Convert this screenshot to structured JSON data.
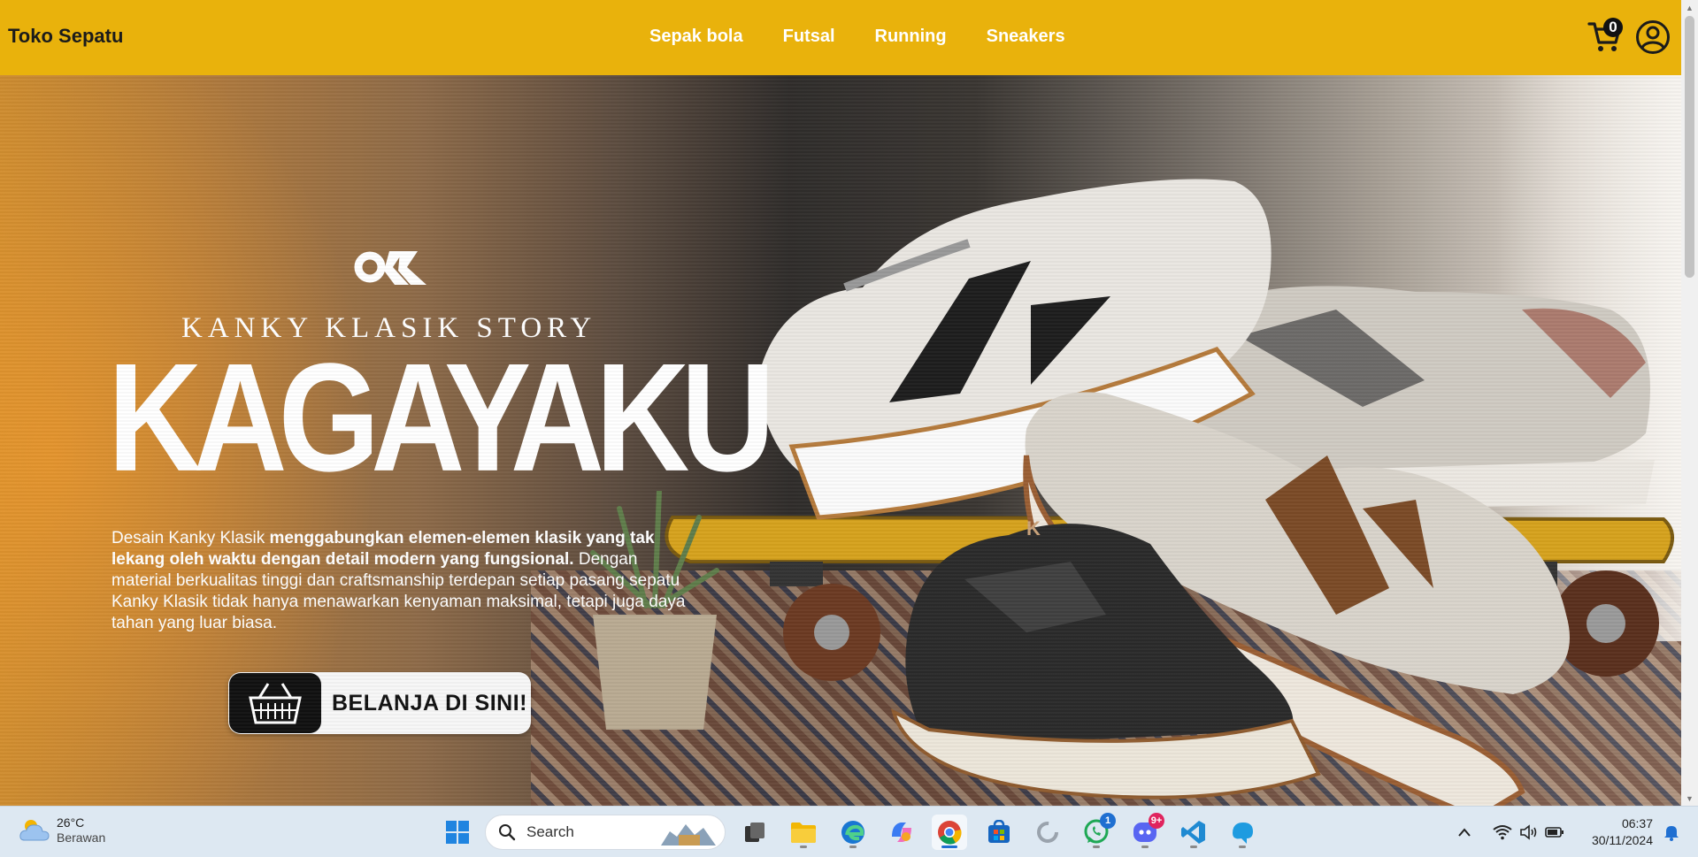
{
  "header": {
    "brand": "Toko Sepatu",
    "nav": [
      "Sepak bola",
      "Futsal",
      "Running",
      "Sneakers"
    ],
    "cart_count": "0",
    "brand_color": "#e9b20c"
  },
  "hero": {
    "logo_text": "OK",
    "story": "KANKY KLASIK STORY",
    "title": "KAGAYAKU",
    "desc_1": "Desain Kanky Klasik ",
    "desc_bold": "menggabungkan elemen-elemen klasik yang tak lekang oleh waktu dengan detail modern yang fungsional.",
    "desc_2": " Dengan material berkualitas tinggi dan craftsmanship terdepan setiap pasang sepatu Kanky Klasik tidak hanya menawarkan kenyaman maksimal, tetapi juga daya tahan yang luar biasa.",
    "cta": "BELANJA DI SINI!"
  },
  "taskbar": {
    "weather_temp": "26°C",
    "weather_desc": "Berawan",
    "search_placeholder": "Search",
    "whatsapp_badge": "1",
    "discord_badge": "9+",
    "time": "06:37",
    "date": "30/11/2024",
    "icons": [
      "windows-start",
      "search",
      "task-view",
      "file-explorer",
      "edge",
      "copilot",
      "chrome",
      "microsoft-store",
      "loading-app",
      "whatsapp",
      "discord",
      "vscode",
      "app"
    ]
  }
}
